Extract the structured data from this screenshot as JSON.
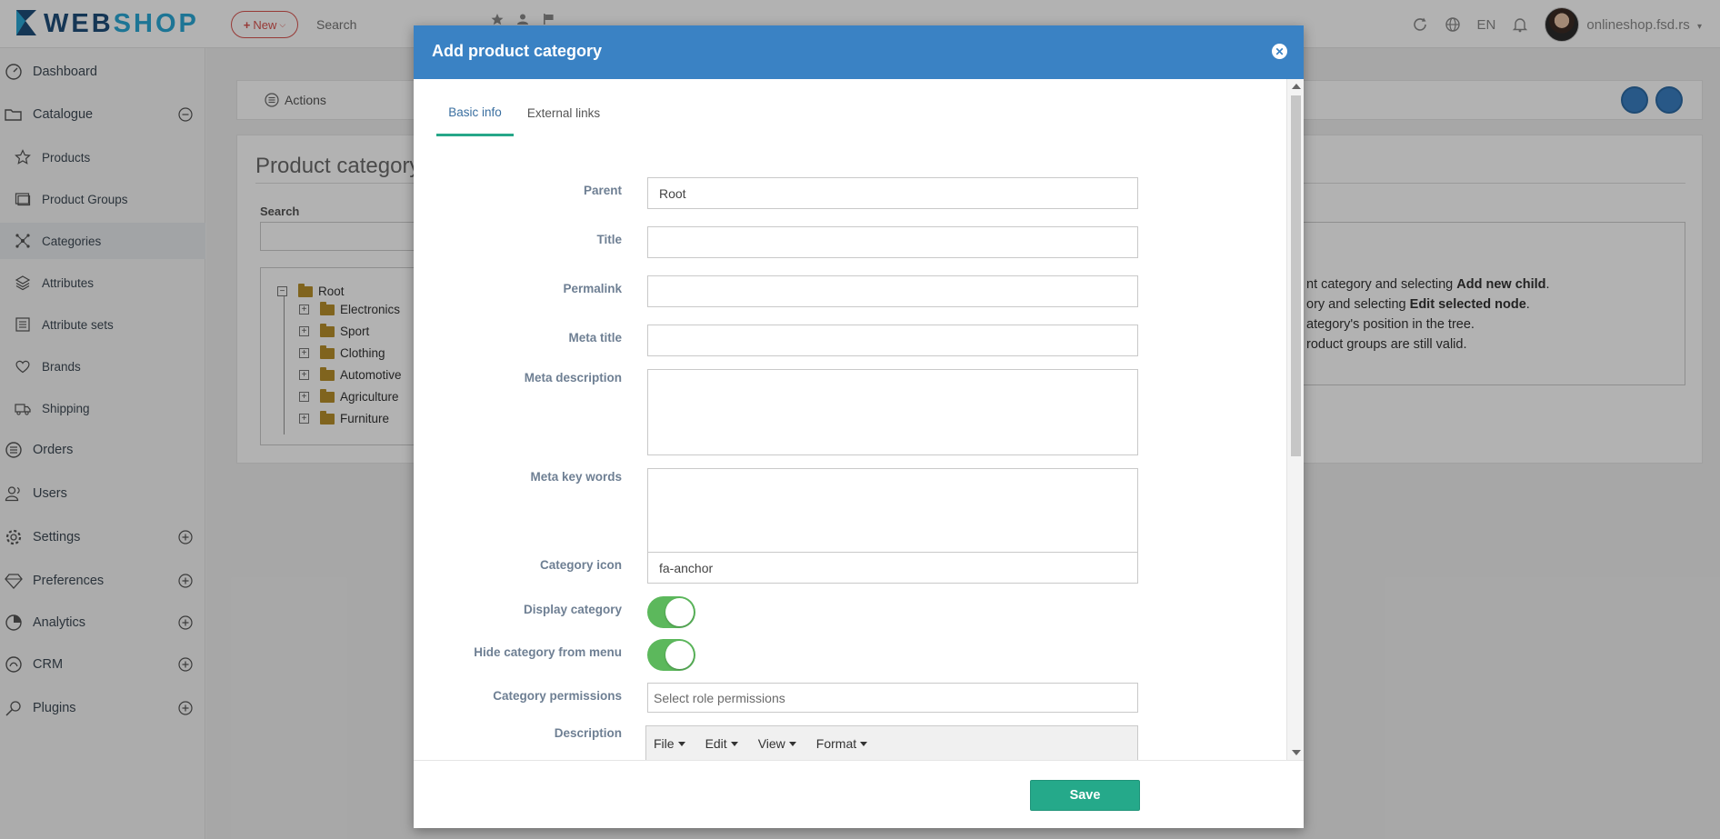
{
  "app": {
    "logo_prefix": "WEB",
    "logo_suffix": "SHOP"
  },
  "topbar": {
    "new_label": "New",
    "search_placeholder": "Search",
    "language": "EN",
    "user": "onlineshop.fsd.rs"
  },
  "sidebar": {
    "items": [
      {
        "label": "Dashboard"
      },
      {
        "label": "Catalogue"
      },
      {
        "label": "Products"
      },
      {
        "label": "Product Groups"
      },
      {
        "label": "Categories"
      },
      {
        "label": "Attributes"
      },
      {
        "label": "Attribute sets"
      },
      {
        "label": "Brands"
      },
      {
        "label": "Shipping"
      },
      {
        "label": "Orders"
      },
      {
        "label": "Users"
      },
      {
        "label": "Settings"
      },
      {
        "label": "Preferences"
      },
      {
        "label": "Analytics"
      },
      {
        "label": "CRM"
      },
      {
        "label": "Plugins"
      }
    ]
  },
  "page": {
    "actions_label": "Actions",
    "title": "Product category",
    "search_label": "Search",
    "tree": {
      "root": "Root",
      "children": [
        "Electronics",
        "Sport",
        "Clothing",
        "Automotive",
        "Agriculture",
        "Furniture"
      ]
    },
    "help_lines": [
      {
        "pre": "nt category and selecting ",
        "bold": "Add new child",
        "post": "."
      },
      {
        "pre": "ory and selecting ",
        "bold": "Edit selected node",
        "post": "."
      },
      {
        "pre": "ategory's position in the tree.",
        "bold": "",
        "post": ""
      },
      {
        "pre": "roduct groups are still valid.",
        "bold": "",
        "post": ""
      }
    ]
  },
  "modal": {
    "title": "Add product category",
    "tabs": [
      {
        "label": "Basic info",
        "active": true
      },
      {
        "label": "External links",
        "active": false
      }
    ],
    "fields": {
      "parent": {
        "label": "Parent",
        "value": "Root"
      },
      "title": {
        "label": "Title",
        "value": ""
      },
      "permalink": {
        "label": "Permalink",
        "value": ""
      },
      "meta_title": {
        "label": "Meta title",
        "value": ""
      },
      "meta_description": {
        "label": "Meta description",
        "value": ""
      },
      "meta_key_words": {
        "label": "Meta key words",
        "value": ""
      },
      "category_icon": {
        "label": "Category icon",
        "value": "fa-anchor"
      },
      "display_category": {
        "label": "Display category",
        "on": true
      },
      "hide_from_menu": {
        "label": "Hide category from menu",
        "on": true
      },
      "permissions": {
        "label": "Category permissions",
        "placeholder": "Select role permissions"
      },
      "description": {
        "label": "Description"
      }
    },
    "editor_menu": [
      "File",
      "Edit",
      "View",
      "Format"
    ],
    "save_label": "Save"
  },
  "colors": {
    "header_blue": "#3a82c4",
    "accent_green": "#25a98a",
    "toggle_green": "#5cb85c",
    "new_red": "#d9534f"
  }
}
